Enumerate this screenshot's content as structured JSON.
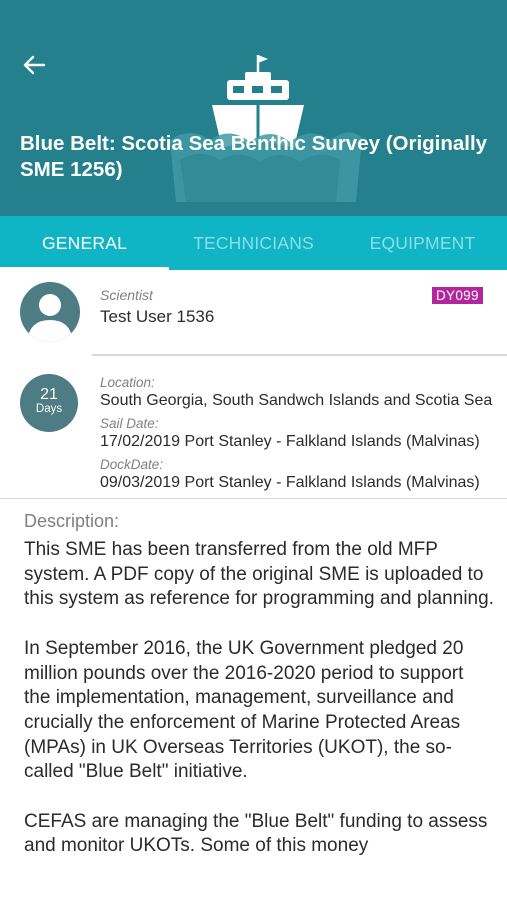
{
  "header": {
    "title": "Blue Belt: Scotia Sea Benthic Survey (Originally SME 1256)",
    "background_color": "#23808c",
    "icons": [
      "back-arrow-icon",
      "ship-icon"
    ]
  },
  "tabs": [
    {
      "label": "GENERAL",
      "active": true
    },
    {
      "label": "TECHNICIANS",
      "active": false
    },
    {
      "label": "EQUIPMENT",
      "active": false
    }
  ],
  "tab_bar_color": "#0fb4c5",
  "scientist": {
    "label": "Scientist",
    "name": "Test User 1536",
    "badge": "DY099",
    "badge_color": "#b3269e"
  },
  "duration": {
    "number": "21",
    "unit": "Days"
  },
  "location": {
    "label": "Location:",
    "value": "South Georgia, South Sandwch Islands and Scotia Sea"
  },
  "sail_date": {
    "label": "Sail Date:",
    "value": "17/02/2019 Port Stanley - Falkland Islands (Malvinas)"
  },
  "dock_date": {
    "label": "DockDate:",
    "value": "09/03/2019 Port Stanley - Falkland Islands (Malvinas)"
  },
  "description": {
    "label": "Description:",
    "paragraphs": [
      "This SME has been transferred from the old MFP system. A PDF copy of the original SME is uploaded to this system as reference for programming and planning.",
      "In September 2016, the UK Government pledged 20 million pounds over the 2016-2020 period to support the implementation, management, surveillance and crucially the enforcement of Marine Protected Areas (MPAs) in UK Overseas Territories (UKOT), the so-called \"Blue Belt\" initiative.",
      "CEFAS are managing the \"Blue Belt\" funding to assess and monitor UKOTs. Some of this money"
    ]
  }
}
